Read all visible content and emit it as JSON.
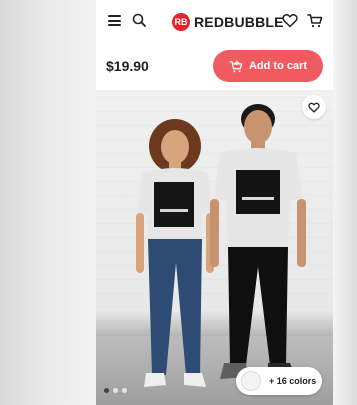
{
  "header": {
    "logo_mark": "RB",
    "logo_text": "REDBUBBLE",
    "icons": [
      "menu-icon",
      "search-icon",
      "heart-icon",
      "cart-icon"
    ]
  },
  "product": {
    "price": "$19.90",
    "add_to_cart_label": "Add to cart",
    "colors_label": "+ 16 colors"
  },
  "gallery": {
    "slide_count": 3,
    "active_slide": 1
  },
  "colors": {
    "brand_red": "#e4252a",
    "button_coral": "#f05a61"
  }
}
